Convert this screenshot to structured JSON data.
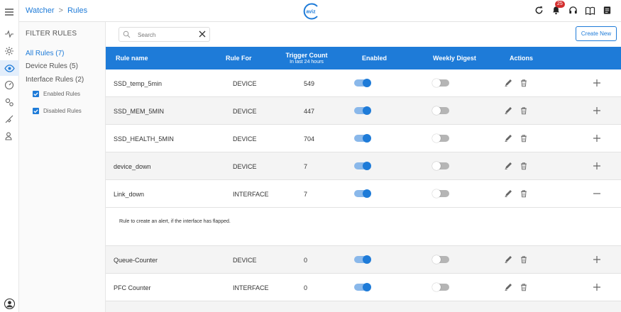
{
  "breadcrumb": {
    "parent": "Watcher",
    "separator": ">",
    "current": "Rules"
  },
  "logo_text": "aviz",
  "notifications": {
    "count": "25"
  },
  "filter": {
    "title": "FILTER RULES",
    "all": "All Rules (7)",
    "device": "Device Rules (5)",
    "interface": "Interface Rules (2)",
    "enabled": "Enabled Rules",
    "disabled": "Disabled Rules"
  },
  "search": {
    "placeholder": "Search"
  },
  "create_label": "Create New",
  "table": {
    "headers": {
      "rule_name": "Rule name",
      "rule_for": "Rule For",
      "trigger": "Trigger Count",
      "trigger_sub": "In last 24 hours",
      "enabled": "Enabled",
      "digest": "Weekly Digest",
      "actions": "Actions"
    },
    "rows": [
      {
        "name": "SSD_temp_5min",
        "for": "DEVICE",
        "count": "549",
        "enabled": true,
        "digest": false,
        "expanded": false
      },
      {
        "name": "SSD_MEM_5MIN",
        "for": "DEVICE",
        "count": "447",
        "enabled": true,
        "digest": false,
        "expanded": false
      },
      {
        "name": "SSD_HEALTH_5MIN",
        "for": "DEVICE",
        "count": "704",
        "enabled": true,
        "digest": false,
        "expanded": false
      },
      {
        "name": "device_down",
        "for": "DEVICE",
        "count": "7",
        "enabled": true,
        "digest": false,
        "expanded": false
      },
      {
        "name": "Link_down",
        "for": "INTERFACE",
        "count": "7",
        "enabled": true,
        "digest": false,
        "expanded": true
      },
      {
        "name": "Queue-Counter",
        "for": "DEVICE",
        "count": "0",
        "enabled": true,
        "digest": false,
        "expanded": false
      },
      {
        "name": "PFC Counter",
        "for": "INTERFACE",
        "count": "0",
        "enabled": true,
        "digest": false,
        "expanded": false
      }
    ],
    "expanded_description": "Rule to create an alert, if the interface has flapped."
  },
  "colors": {
    "accent": "#1e7bd8",
    "badge": "#d32f2f",
    "toggle_off": "#b5b5b5"
  },
  "icons": {
    "rail": [
      "menu-icon",
      "activity-icon",
      "settings-icon",
      "watcher-eye-icon",
      "gauge-icon",
      "gears-icon",
      "plug-icon",
      "user-search-icon"
    ],
    "top": [
      "refresh-icon",
      "bell-icon",
      "headset-icon",
      "book-icon",
      "document-icon"
    ]
  }
}
